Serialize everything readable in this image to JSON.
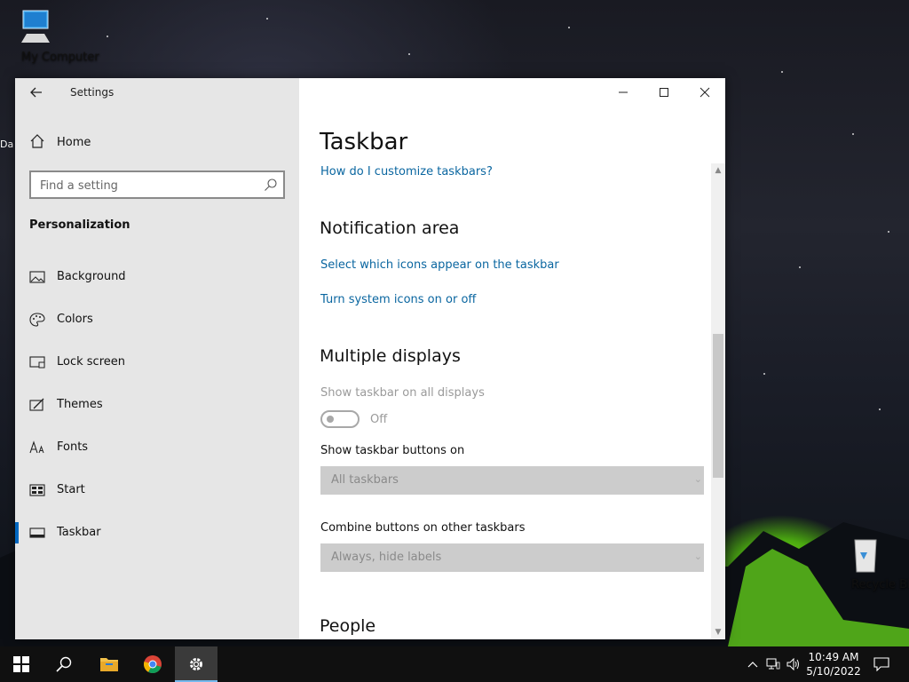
{
  "desktop": {
    "icons": [
      {
        "label": "My Computer"
      },
      {
        "label": "Recycle Bin"
      }
    ],
    "partial_label": "Da"
  },
  "window": {
    "title": "Settings",
    "sidebar": {
      "home_label": "Home",
      "search_placeholder": "Find a setting",
      "section_title": "Personalization",
      "items": [
        {
          "label": "Background",
          "icon": "image-icon"
        },
        {
          "label": "Colors",
          "icon": "palette-icon"
        },
        {
          "label": "Lock screen",
          "icon": "lock-screen-icon"
        },
        {
          "label": "Themes",
          "icon": "themes-icon"
        },
        {
          "label": "Fonts",
          "icon": "fonts-icon"
        },
        {
          "label": "Start",
          "icon": "start-icon"
        },
        {
          "label": "Taskbar",
          "icon": "taskbar-icon",
          "selected": true
        }
      ]
    },
    "content": {
      "page_title": "Taskbar",
      "help_link": "How do I customize taskbars?",
      "notification_area": {
        "heading": "Notification area",
        "link_icons": "Select which icons appear on the taskbar",
        "link_system_icons": "Turn system icons on or off"
      },
      "multiple_displays": {
        "heading": "Multiple displays",
        "show_taskbar_label": "Show taskbar on all displays",
        "toggle_state": "Off",
        "buttons_on_label": "Show taskbar buttons on",
        "buttons_on_value": "All taskbars",
        "combine_label": "Combine buttons on other taskbars",
        "combine_value": "Always, hide labels"
      },
      "people_heading": "People"
    }
  },
  "taskbar": {
    "clock_time": "10:49 AM",
    "clock_date": "5/10/2022",
    "accent": "#76b9ed"
  },
  "colors": {
    "link": "#0a66a0",
    "selected_indicator": "#0067c0",
    "sidebar_bg": "#e6e6e6"
  }
}
